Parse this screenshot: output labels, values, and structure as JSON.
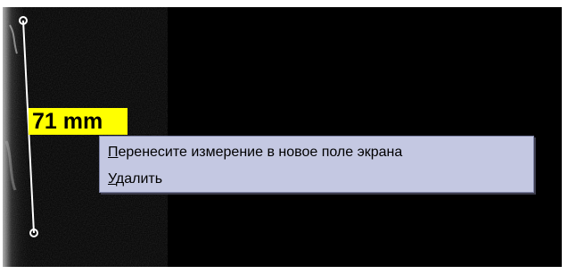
{
  "measurement": {
    "label": "71 mm",
    "label_color": "#ffff00",
    "line_color": "#ffffff"
  },
  "context_menu": {
    "items": [
      {
        "accel": "П",
        "rest": "еренесите измерение в новое поле экрана"
      },
      {
        "accel": "У",
        "rest": "далить"
      }
    ],
    "background": "#c4c8e2"
  },
  "viewer": {
    "background": "#000000"
  },
  "icons": {
    "endpoint": "ruler-endpoint-icon"
  }
}
